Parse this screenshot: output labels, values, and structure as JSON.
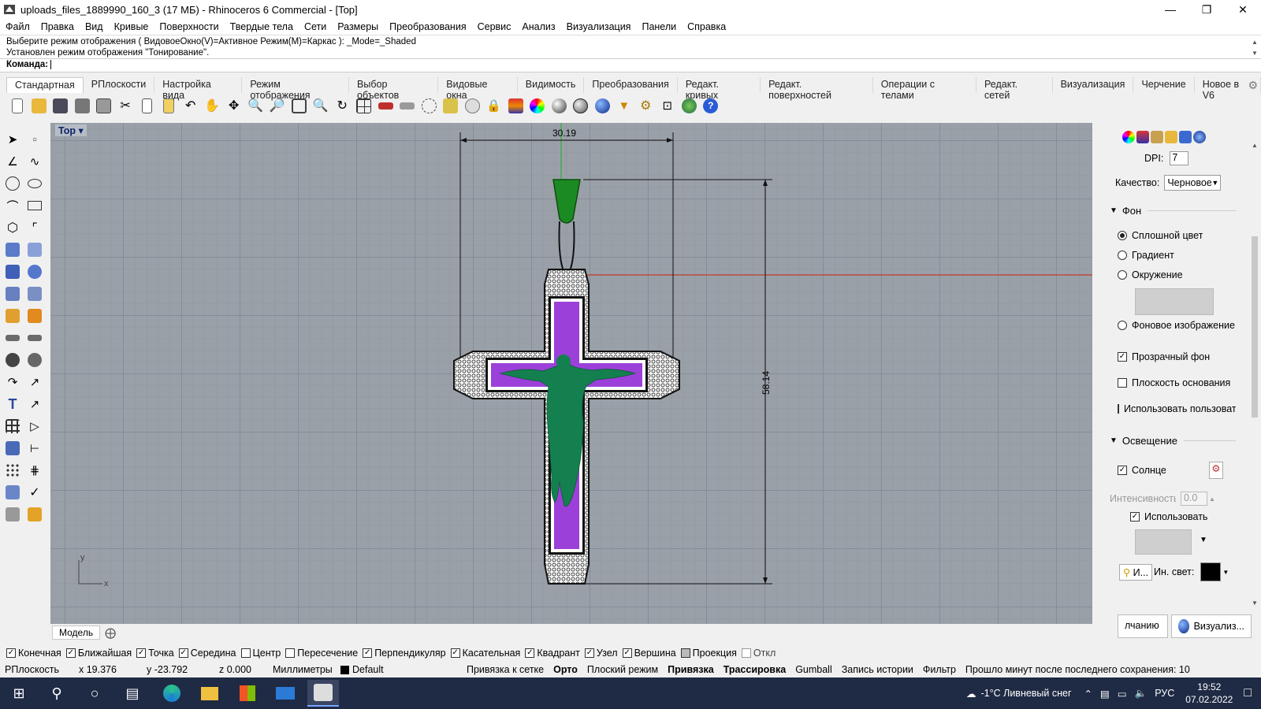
{
  "window": {
    "title": "uploads_files_1889990_160_3 (17 МБ) - Rhinoceros 6 Commercial - [Top]"
  },
  "menu": [
    "Файл",
    "Правка",
    "Вид",
    "Кривые",
    "Поверхности",
    "Твердые тела",
    "Сети",
    "Размеры",
    "Преобразования",
    "Сервис",
    "Анализ",
    "Визуализация",
    "Панели",
    "Справка"
  ],
  "command": {
    "history1": "Выберите режим отображения ( ВидовоеОкно(V)=Активное  Режим(M)=Каркас ): _Mode=_Shaded",
    "history2": "Установлен режим отображения \"Тонирование\".",
    "prompt": "Команда:"
  },
  "tabs": [
    "Стандартная",
    "РПлоскости",
    "Настройка вида",
    "Режим отображения",
    "Выбор объектов",
    "Видовые окна",
    "Видимость",
    "Преобразования",
    "Редакт. кривых",
    "Редакт. поверхностей",
    "Операции с телами",
    "Редакт. сетей",
    "Визуализация",
    "Черчение",
    "Новое в V6"
  ],
  "viewport": {
    "name": "Top",
    "dim_width": "30.19",
    "dim_height": "58.14",
    "axis_x": "x",
    "axis_y": "y"
  },
  "model_tab": "Модель",
  "panel": {
    "dpi_label": "DPI:",
    "dpi_value": "7",
    "quality_label": "Качество:",
    "quality_value": "Черновое",
    "bg_section": "Фон",
    "bg_solid": "Сплошной цвет",
    "bg_gradient": "Градиент",
    "bg_env": "Окружение",
    "bg_image": "Фоновое изображение",
    "transparent_bg": "Прозрачный фон",
    "ground_plane": "Плоскость основания",
    "use_custom": "Использовать пользовательский",
    "light_section": "Освещение",
    "sun": "Солнце",
    "intensity_label": "Интенсивность:",
    "intensity_value": "0.0",
    "use_label": "Использовать",
    "ambient_label": "Ин. свет:",
    "ambient_btn": "И...",
    "tab_default": "лчанию",
    "tab_render": "Визуализ..."
  },
  "osnaps": [
    {
      "label": "Конечная",
      "on": true
    },
    {
      "label": "Ближайшая",
      "on": true
    },
    {
      "label": "Точка",
      "on": true
    },
    {
      "label": "Середина",
      "on": true
    },
    {
      "label": "Центр",
      "on": false
    },
    {
      "label": "Пересечение",
      "on": false
    },
    {
      "label": "Перпендикуляр",
      "on": true
    },
    {
      "label": "Касательная",
      "on": true
    },
    {
      "label": "Квадрант",
      "on": true
    },
    {
      "label": "Узел",
      "on": true
    },
    {
      "label": "Вершина",
      "on": true
    },
    {
      "label": "Проекция",
      "on": false
    },
    {
      "label": "Откл",
      "on": false
    }
  ],
  "status": {
    "cplane": "РПлоскость",
    "x": "x 19.376",
    "y": "y -23.792",
    "z": "z 0.000",
    "units": "Миллиметры",
    "layer": "Default",
    "grid_snap": "Привязка к сетке",
    "ortho": "Орто",
    "planar": "Плоский режим",
    "osnap": "Привязка",
    "smarttrack": "Трассировка",
    "gumball": "Gumball",
    "history": "Запись истории",
    "filter": "Фильтр",
    "saved": "Прошло минут после последнего сохранения: 10"
  },
  "taskbar": {
    "weather": "-1°C  Ливневый снег",
    "lang": "РУС",
    "time": "19:52",
    "date": "07.02.2022"
  },
  "colors": {
    "enamel": "#9b40d8",
    "bail": "#1c8a22",
    "figure": "#14804f",
    "accent_axis": "#c0392b"
  }
}
